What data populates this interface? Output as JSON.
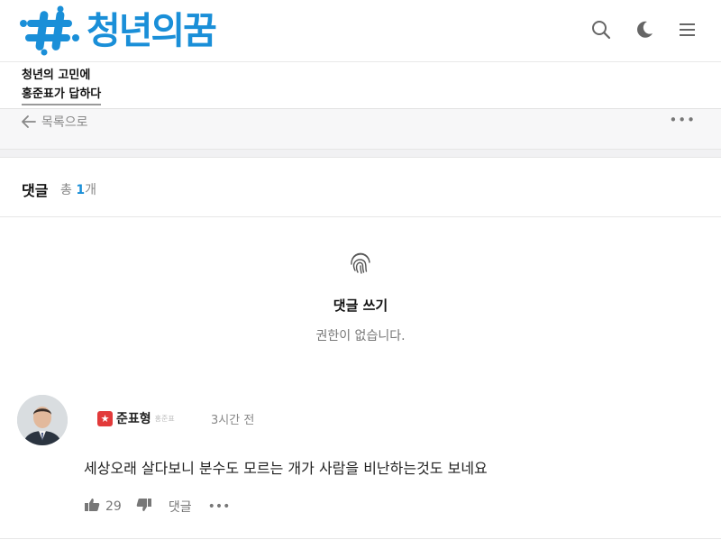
{
  "header": {
    "logo_text": "청년의꿈",
    "brand_color": "#1a8fd8",
    "icons": [
      "search-icon",
      "moon-icon",
      "menu-icon"
    ]
  },
  "board": {
    "title_line1": "청년의 고민에",
    "title_line2": "홍준표가 답하다"
  },
  "list_bar": {
    "back_label": "목록으로",
    "more_label": "•••"
  },
  "comments": {
    "title": "댓글",
    "count_prefix": "총",
    "count": "1",
    "count_suffix": "개",
    "write_label": "댓글 쓰기",
    "permission_text": "권한이 없습니다."
  },
  "comment": {
    "badge_color": "#e23a3a",
    "author": "준표형",
    "author_sub": "홍준표",
    "time": "3시간 전",
    "text": "세상오래 살다보니 분수도 모르는 개가 사람을 비난하는것도 보네요",
    "like_count": "29",
    "reply_label": "댓글",
    "more_label": "•••"
  }
}
